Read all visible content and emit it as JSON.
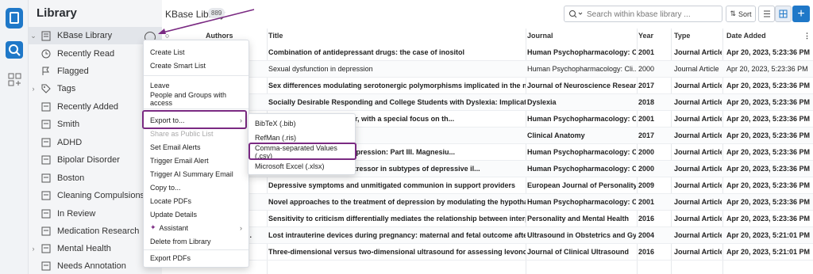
{
  "app": {
    "library_title": "Library"
  },
  "rail": {
    "logo_icon": "book-icon",
    "search_icon": "search-icon",
    "apps_icon": "apps-grid-icon"
  },
  "sidebar": {
    "root": "KBase Library",
    "items": [
      {
        "label": "Recently Read",
        "icon": "clock-icon"
      },
      {
        "label": "Flagged",
        "icon": "flag-icon"
      },
      {
        "label": "Tags",
        "icon": "tag-icon"
      },
      {
        "label": "Recently Added",
        "icon": "list-icon"
      },
      {
        "label": "Smith",
        "icon": "list-icon"
      },
      {
        "label": "ADHD",
        "icon": "list-icon"
      },
      {
        "label": "Bipolar Disorder",
        "icon": "list-icon"
      },
      {
        "label": "Boston",
        "icon": "list-icon"
      },
      {
        "label": "Cleaning Compulsions",
        "icon": "list-icon"
      },
      {
        "label": "In Review",
        "icon": "list-icon"
      },
      {
        "label": "Medication Research",
        "icon": "list-icon"
      },
      {
        "label": "Mental Health",
        "icon": "list-icon"
      },
      {
        "label": "Needs Annotation",
        "icon": "list-icon"
      }
    ]
  },
  "header": {
    "title": "KBase Library",
    "count": "889",
    "search_placeholder": "Search within kbase library ...",
    "sort_label": "Sort",
    "add_label": "+"
  },
  "table": {
    "columns": {
      "authors": "Authors",
      "title": "Title",
      "journal": "Journal",
      "year": "Year",
      "type": "Type",
      "date_added": "Date Added"
    },
    "rows": [
      {
        "author": "",
        "title": "Combination of antidepressant drugs: the case of inositol",
        "journal": "Human Psychopharmacology: Cli...",
        "year": "2001",
        "type": "Journal Article",
        "date": "Apr 20, 2023, 5:23:36 PM",
        "bold": true
      },
      {
        "author": "",
        "title": "Sexual dysfunction in depression",
        "journal": "Human Psychopharmacology: Cli...",
        "year": "2000",
        "type": "Journal Article",
        "date": "Apr 20, 2023, 5:23:36 PM",
        "bold": false
      },
      {
        "author": "",
        "title": "Sex differences modulating serotonergic polymorphisms implicated in the mecha...",
        "journal": "Journal of Neuroscience Research",
        "year": "2017",
        "type": "Journal Article",
        "date": "Apr 20, 2023, 5:23:36 PM",
        "bold": true
      },
      {
        "author": "",
        "title": "Socially Desirable Responding and College Students with Dyslexia: Implications fo...",
        "journal": "Dyslexia",
        "year": "2018",
        "type": "Journal Article",
        "date": "Apr 20, 2023, 5:23:36 PM",
        "bold": true
      },
      {
        "author": "",
        "title": "major depressive disorder, with a special focus on th...",
        "journal": "Human Psychopharmacology: Cli...",
        "year": "2001",
        "type": "Journal Article",
        "date": "Apr 20, 2023, 5:23:36 PM",
        "bold": true
      },
      {
        "author": "",
        "title": "sion: A review",
        "journal": "Clinical Anatomy",
        "year": "2017",
        "type": "Journal Article",
        "date": "Apr 20, 2023, 5:23:36 PM",
        "bold": true
      },
      {
        "author": "",
        "title": "nal models and human depression: Part III. Magnesiu...",
        "journal": "Human Psychopharmacology: Cli...",
        "year": "2000",
        "type": "Journal Article",
        "date": "Apr 20, 2023, 5:23:36 PM",
        "bold": true
      },
      {
        "author": "",
        "title": "response to a cognitive stressor in subtypes of depressive il...",
        "journal": "Human Psychopharmacology: Cli...",
        "year": "2000",
        "type": "Journal Article",
        "date": "Apr 20, 2023, 5:23:36 PM",
        "bold": true
      },
      {
        "author": "",
        "title": "Depressive symptoms and unmitigated communion in support providers",
        "journal": "European Journal of Personality",
        "year": "2009",
        "type": "Journal Article",
        "date": "Apr 20, 2023, 5:23:36 PM",
        "bold": true
      },
      {
        "author": "",
        "title": "Novel approaches to the treatment of depression by modulating the hypothalamic ...",
        "journal": "Human Psychopharmacology: Cli...",
        "year": "2001",
        "type": "Journal Article",
        "date": "Apr 20, 2023, 5:23:36 PM",
        "bold": true
      },
      {
        "author": "",
        "title": "Sensitivity to criticism differentially mediates the relationship between interperso...",
        "journal": "Personality and Mental Health",
        "year": "2016",
        "type": "Journal Article",
        "date": "Apr 20, 2023, 5:23:36 PM",
        "bold": true
      },
      {
        "author": "l.",
        "title": "Lost intrauterine devices during pregnancy: maternal and fetal outcome after ultra...",
        "journal": "Ultrasound in Obstetrics and Gyn...",
        "year": "2004",
        "type": "Journal Article",
        "date": "Apr 20, 2023, 5:21:01 PM",
        "bold": true
      },
      {
        "author": "",
        "title": "Three-dimensional versus two-dimensional ultrasound for assessing levonorgestr...",
        "journal": "Journal of Clinical Ultrasound",
        "year": "2016",
        "type": "Journal Article",
        "date": "Apr 20, 2023, 5:21:01 PM",
        "bold": true
      }
    ]
  },
  "context_menu": {
    "create_list": "Create List",
    "create_smart_list": "Create Smart List",
    "leave": "Leave",
    "people_groups": "People and Groups with access",
    "export_to": "Export to...",
    "share_public": "Share as Public List",
    "email_alerts": "Set Email Alerts",
    "trigger_email": "Trigger Email Alert",
    "trigger_ai": "Trigger AI Summary Email",
    "copy_to": "Copy to...",
    "locate_pdfs": "Locate PDFs",
    "update_details": "Update Details",
    "assistant": "Assistant",
    "delete": "Delete from Library",
    "export_pdfs": "Export PDFs"
  },
  "export_submenu": {
    "bibtex": "BibTeX (.bib)",
    "refman": "RefMan (.ris)",
    "csv": "Comma-separated Values (.csv)",
    "excel": "Microsoft Excel (.xlsx)"
  },
  "colors": {
    "accent": "#1f78c8",
    "highlight": "#7a2a82"
  }
}
